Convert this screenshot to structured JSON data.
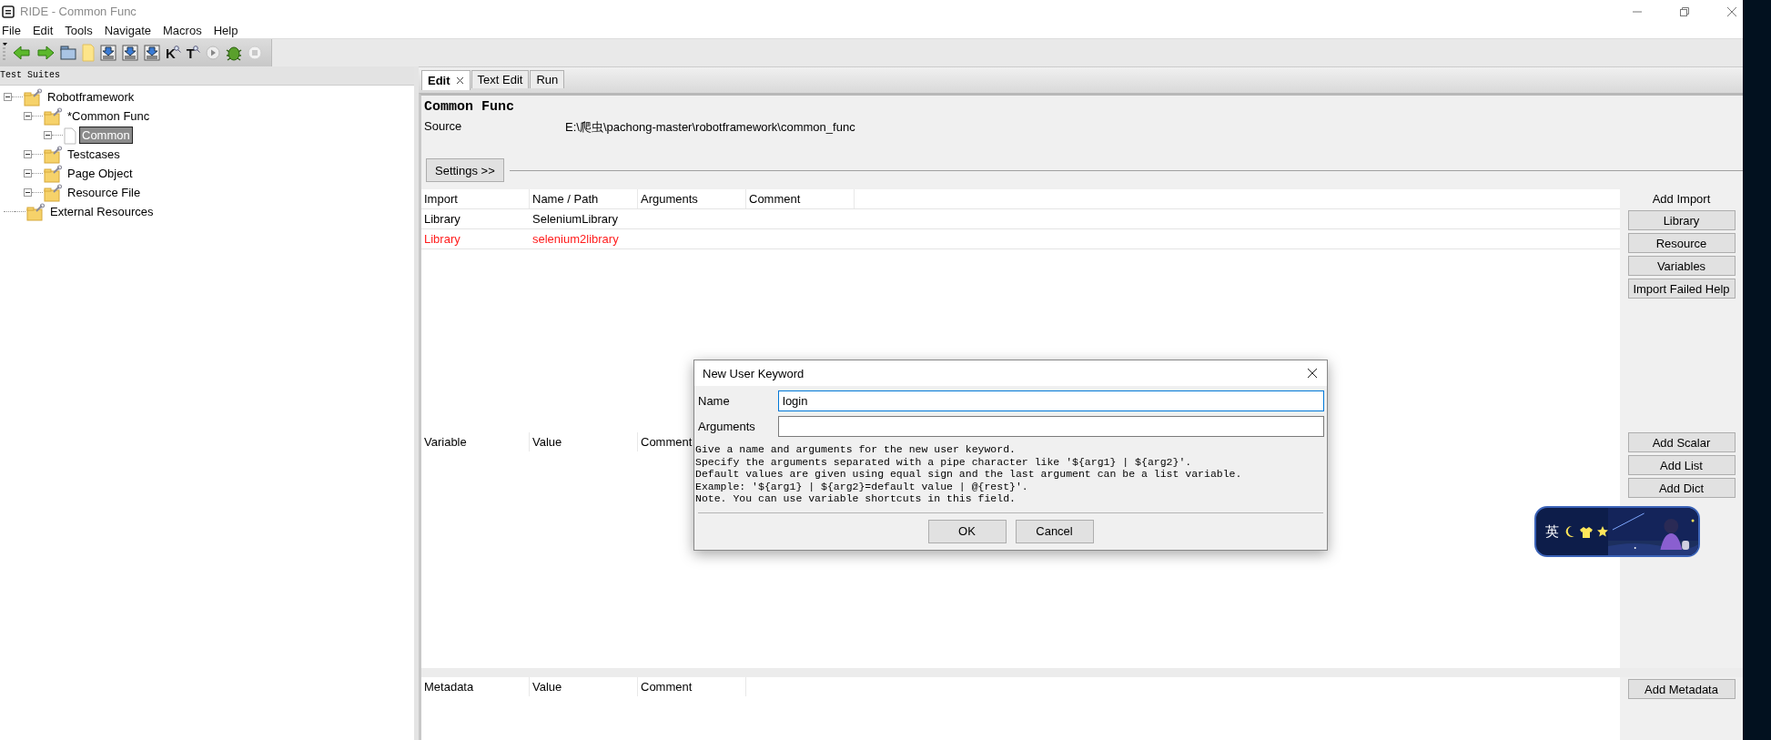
{
  "window": {
    "title": "RIDE - Common Func"
  },
  "menu": [
    "File",
    "Edit",
    "Tools",
    "Navigate",
    "Macros",
    "Help"
  ],
  "toolbar": [
    {
      "kind": "back"
    },
    {
      "kind": "forward"
    },
    {
      "kind": "open"
    },
    {
      "kind": "new"
    },
    {
      "kind": "save"
    },
    {
      "kind": "save"
    },
    {
      "kind": "save"
    },
    {
      "kind": "find",
      "label": "K"
    },
    {
      "kind": "find",
      "label": "T"
    },
    {
      "kind": "run"
    },
    {
      "kind": "debug"
    },
    {
      "kind": "stop"
    }
  ],
  "tree": {
    "title": "Test Suites",
    "items": [
      {
        "label": "Robotframework",
        "kind": "suite",
        "expanded": true,
        "selected": false,
        "children": [
          {
            "label": "*Common Func",
            "kind": "suite",
            "expanded": true,
            "selected": false,
            "children": [
              {
                "label": "Common",
                "kind": "keyword",
                "expanded": true,
                "selected": true
              }
            ]
          },
          {
            "label": "Testcases",
            "kind": "suite",
            "expanded": true,
            "selected": false
          },
          {
            "label": "Page Object",
            "kind": "suite",
            "expanded": true,
            "selected": false
          },
          {
            "label": "Resource File",
            "kind": "suite",
            "expanded": true,
            "selected": false
          }
        ]
      },
      {
        "label": "External Resources",
        "kind": "suite",
        "selected": false
      }
    ]
  },
  "tabs": [
    {
      "label": "Edit",
      "selected": true,
      "closable": true
    },
    {
      "label": "Text Edit",
      "selected": false,
      "closable": false
    },
    {
      "label": "Run",
      "selected": false,
      "closable": false
    }
  ],
  "editor": {
    "title": "Common Func",
    "source_label": "Source",
    "source": "E:\\爬虫\\pachong-master\\robotframework\\common_func",
    "settings_button": "Settings >>",
    "imports": {
      "columns": [
        "Import",
        "Name / Path",
        "Arguments",
        "Comment"
      ],
      "rows": [
        {
          "cells": [
            "Library",
            "SeleniumLibrary"
          ],
          "error": false
        },
        {
          "cells": [
            "Library",
            "selenium2library"
          ],
          "error": true
        }
      ]
    },
    "import_actions": {
      "title": "Add Import",
      "buttons": [
        "Library",
        "Resource",
        "Variables",
        "Import Failed Help"
      ]
    },
    "variables": {
      "columns": [
        "Variable",
        "Value",
        "Comment"
      ]
    },
    "variable_actions": [
      "Add Scalar",
      "Add List",
      "Add Dict"
    ],
    "metadata": {
      "columns": [
        "Metadata",
        "Value",
        "Comment"
      ]
    },
    "metadata_actions": [
      "Add Metadata"
    ]
  },
  "dialog": {
    "title": "New User Keyword",
    "fields": [
      {
        "label": "Name",
        "value": "login",
        "focused": true
      },
      {
        "label": "Arguments",
        "focused": false
      }
    ],
    "help": [
      "Give a name and arguments for the new user keyword.",
      "Specify the arguments separated with a pipe character like '${arg1} | ${arg2}'.",
      "Default values are given using equal sign and the last argument can be a list variable.",
      "Example: '${arg1} | ${arg2}=default value | @{rest}'.",
      "Note. You can use variable shortcuts in this field."
    ],
    "buttons": [
      "OK",
      "Cancel"
    ]
  },
  "ime": {
    "label": "英"
  }
}
